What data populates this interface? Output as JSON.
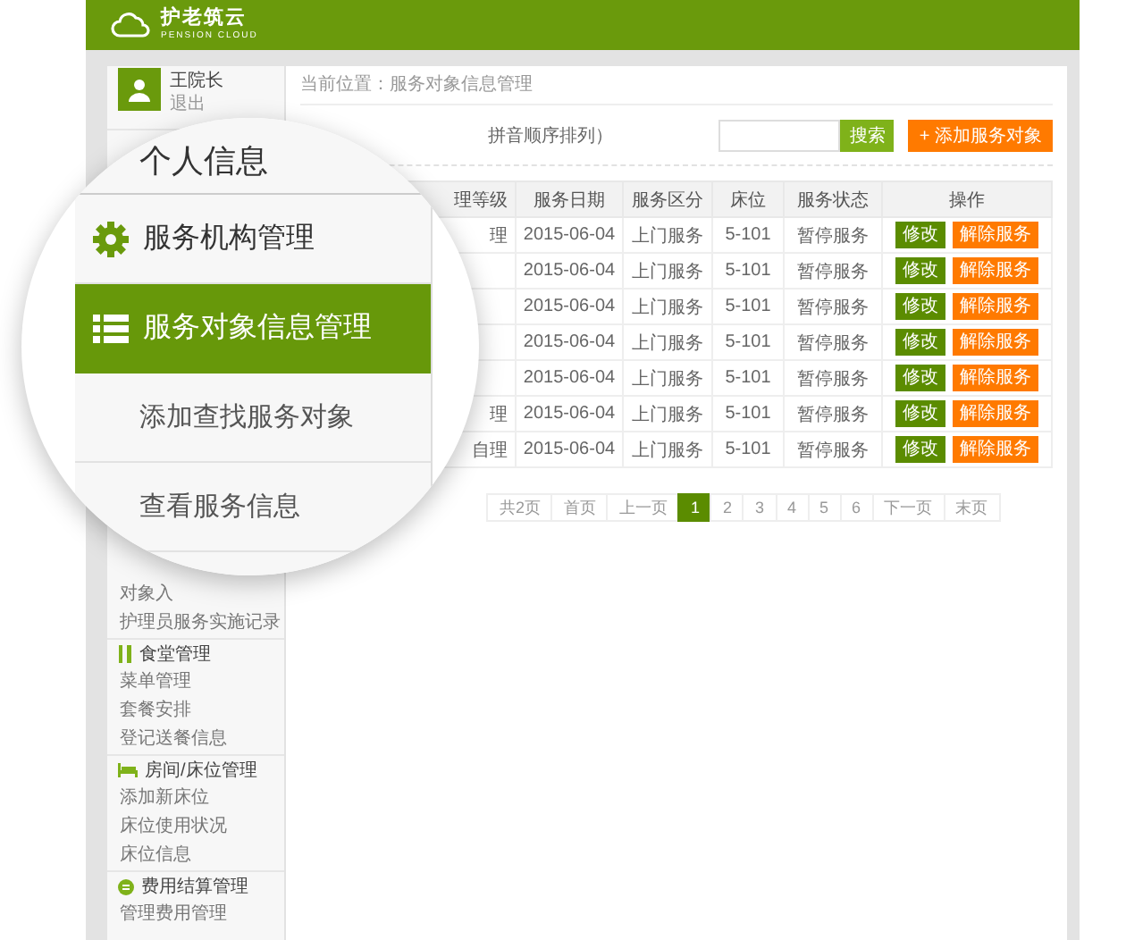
{
  "header": {
    "logo_text": "护老筑云",
    "logo_subtitle": "PENSION CLOUD"
  },
  "user": {
    "name": "王院长",
    "logout": "退出"
  },
  "sidebar": {
    "items": [
      "对象入",
      "护理员服务实施记录"
    ],
    "sections": [
      {
        "title": "食堂管理",
        "items": [
          "菜单管理",
          "套餐安排",
          "登记送餐信息"
        ]
      },
      {
        "title": "房间/床位管理",
        "items": [
          "添加新床位",
          "床位使用状况",
          "床位信息"
        ]
      },
      {
        "title": "费用结算管理",
        "items": [
          "管理费用管理"
        ]
      }
    ]
  },
  "breadcrumb": "当前位置：服务对象信息管理",
  "list_title": "拼音顺序排列）",
  "search": {
    "button": "搜索"
  },
  "add_button": "+ 添加服务对象",
  "table": {
    "columns": [
      "理等级",
      "服务日期",
      "服务区分",
      "床位",
      "服务状态",
      "操作"
    ],
    "rows": [
      {
        "level": "理",
        "date": "2015-06-04",
        "type": "上门服务",
        "bed": "5-101",
        "status": "暂停服务",
        "actions": [
          "修改",
          "解除服务"
        ]
      },
      {
        "date": "2015-06-04",
        "type": "上门服务",
        "bed": "5-101",
        "status": "暂停服务",
        "actions": [
          "修改",
          "解除服务"
        ]
      },
      {
        "date": "2015-06-04",
        "type": "上门服务",
        "bed": "5-101",
        "status": "暂停服务",
        "actions": [
          "修改",
          "解除服务"
        ]
      },
      {
        "date": "2015-06-04",
        "type": "上门服务",
        "bed": "5-101",
        "status": "暂停服务",
        "actions": [
          "修改",
          "解除服务"
        ]
      },
      {
        "date": "2015-06-04",
        "type": "上门服务",
        "bed": "5-101",
        "status": "暂停服务",
        "actions": [
          "修改",
          "解除服务"
        ]
      },
      {
        "level": "理",
        "date": "2015-06-04",
        "type": "上门服务",
        "bed": "5-101",
        "status": "暂停服务",
        "actions": [
          "修改",
          "解除服务"
        ]
      },
      {
        "level": "自理",
        "date": "2015-06-04",
        "type": "上门服务",
        "bed": "5-101",
        "status": "暂停服务",
        "actions": [
          "修改",
          "解除服务"
        ]
      }
    ]
  },
  "pagination": [
    {
      "label": "共2页",
      "selected": false
    },
    {
      "label": "首页",
      "selected": false
    },
    {
      "label": "上一页",
      "selected": false
    },
    {
      "label": "1",
      "selected": true
    },
    {
      "label": "2",
      "selected": false
    },
    {
      "label": "3",
      "selected": false
    },
    {
      "label": "4",
      "selected": false
    },
    {
      "label": "5",
      "selected": false
    },
    {
      "label": "6",
      "selected": false
    },
    {
      "label": "下一页",
      "selected": false
    },
    {
      "label": "末页",
      "selected": false
    }
  ],
  "magnifier": {
    "title": "个人信息",
    "items": [
      {
        "label": "服务机构管理",
        "kind": "section",
        "selected": false
      },
      {
        "label": "服务对象信息管理",
        "kind": "section",
        "selected": true
      },
      {
        "label": "添加查找服务对象",
        "kind": "link",
        "selected": false
      },
      {
        "label": "查看服务信息",
        "kind": "link",
        "selected": false
      }
    ]
  }
}
